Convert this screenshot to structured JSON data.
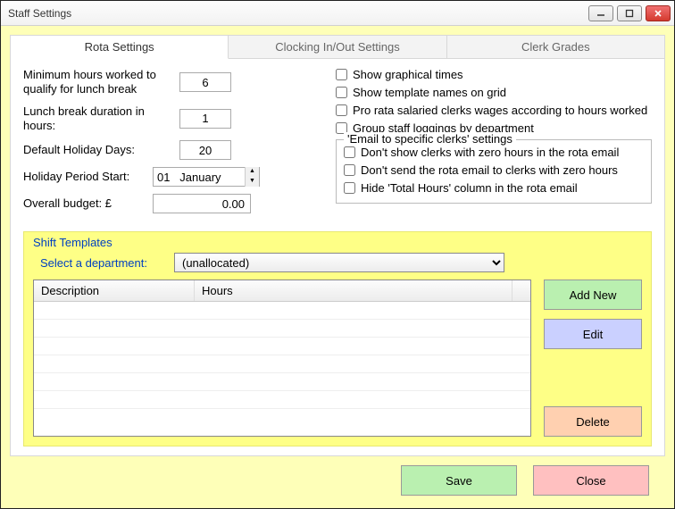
{
  "window": {
    "title": "Staff Settings"
  },
  "tabs": {
    "rota": "Rota Settings",
    "clock": "Clocking In/Out Settings",
    "grades": "Clerk Grades"
  },
  "rota": {
    "labels": {
      "min_hours": "Minimum hours worked to qualify for lunch break",
      "lunch_duration": "Lunch break duration in hours:",
      "default_holiday": "Default Holiday Days:",
      "holiday_start": "Holiday Period Start:",
      "overall_budget": "Overall budget: £"
    },
    "values": {
      "min_hours": "6",
      "lunch_duration": "1",
      "default_holiday": "20",
      "holiday_start": "01   January",
      "overall_budget": "0.00"
    },
    "checks": {
      "show_graphical": "Show graphical times",
      "show_template_names": "Show template names on grid",
      "pro_rata": "Pro rata salaried clerks wages according to hours worked",
      "group_by_dept": "Group staff loggings by department"
    },
    "email_group": {
      "legend": "'Email to specific clerks' settings",
      "hide_zero": "Don't show clerks with zero hours in the rota email",
      "no_send_zero": "Don't send the rota email to clerks with zero hours",
      "hide_total": "Hide 'Total Hours' column in the rota email"
    }
  },
  "shift": {
    "title": "Shift Templates",
    "select_label": "Select a department:",
    "selected_dept": "(unallocated)",
    "columns": {
      "description": "Description",
      "hours": "Hours"
    },
    "buttons": {
      "add": "Add New",
      "edit": "Edit",
      "delete": "Delete"
    }
  },
  "footer": {
    "save": "Save",
    "close": "Close"
  }
}
